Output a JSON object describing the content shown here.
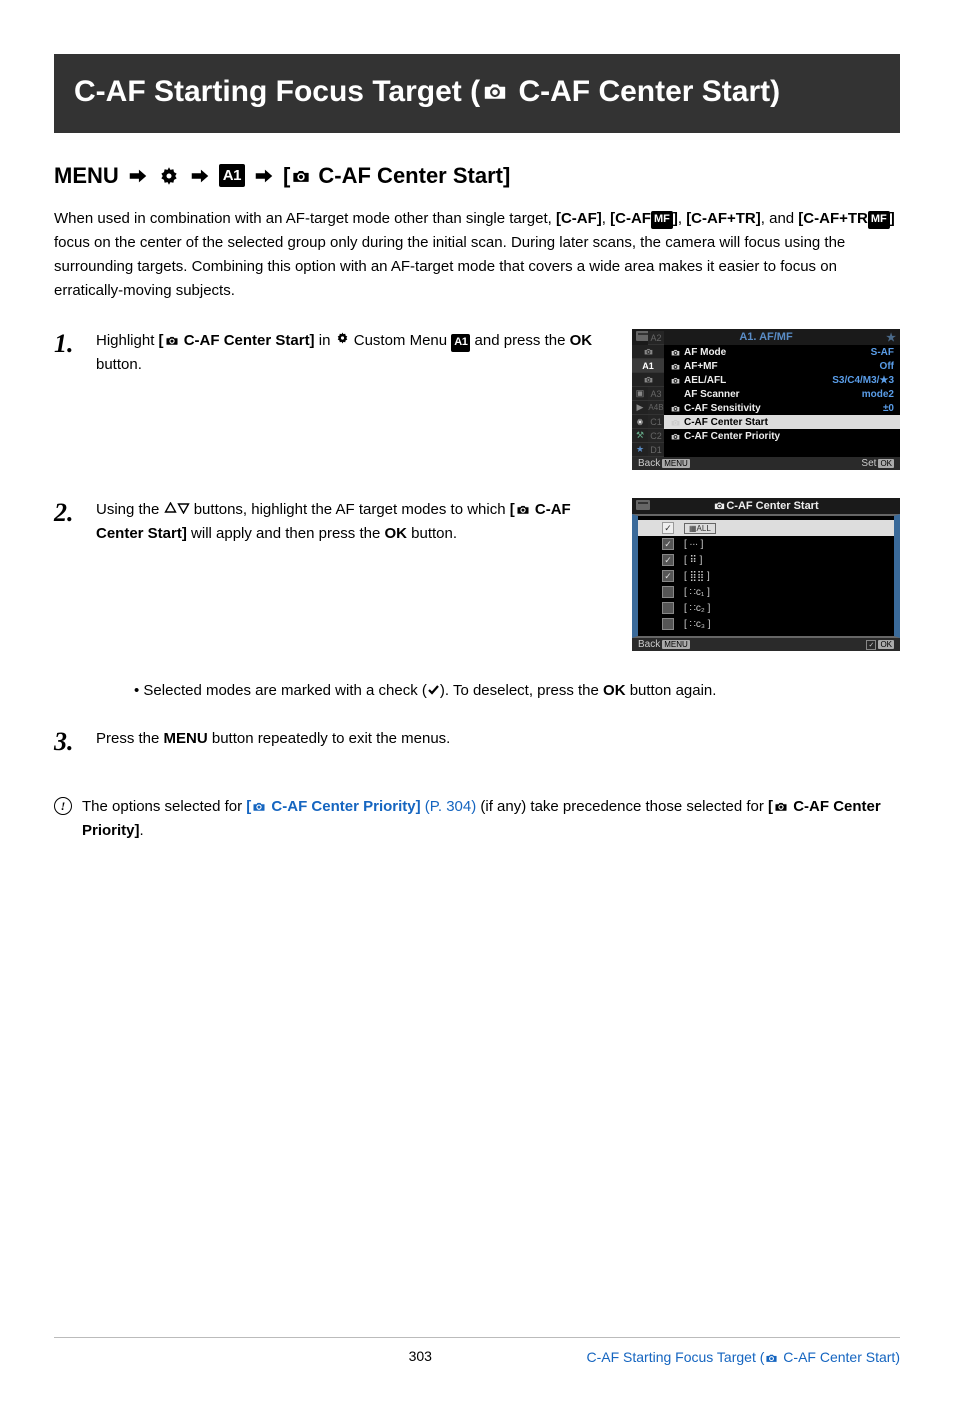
{
  "title_bar": {
    "prefix": "C-AF Starting Focus Target (",
    "label": " C-AF Center Start)"
  },
  "menu_path": {
    "menu": "MENU",
    "label_prefix": " [",
    "label": " C-AF Center Start]"
  },
  "intro": {
    "t1": "When used in combination with an AF-target mode other than single target, ",
    "caf": "[C-AF]",
    "t2": ", ",
    "cafmf": "[C-AF",
    "mf": "MF",
    "t3": "]",
    "t4": ", ",
    "caftr": "[C-AF+TR]",
    "t5": ", and ",
    "caftrmf": "[C-AF+TR",
    "t6": "]",
    "t7": " focus on the center of the selected group only during the initial scan. During later scans, the camera will focus using the surrounding targets. Combining this option with an AF-target mode that covers a wide area makes it easier to focus on erratically-moving subjects."
  },
  "steps": {
    "s1": {
      "num": "1.",
      "t1": "Highlight ",
      "bold1": "[",
      "bold_label": " C-AF Center Start]",
      "t2": " in ",
      "t3": " Custom Menu ",
      "t4": " and press the ",
      "ok": "OK",
      "t5": " button."
    },
    "s2": {
      "num": "2.",
      "t1": "Using the ",
      "t2": " buttons, highlight the AF target modes to which ",
      "bold1": "[",
      "bold_label": " C-AF Center Start]",
      "t3": " will apply and then press the ",
      "ok": "OK",
      "t4": " button."
    },
    "bullet": {
      "t1": "Selected modes are marked with a check (",
      "t2": "). To deselect, press the ",
      "ok": "OK",
      "t3": " button again."
    },
    "s3": {
      "num": "3.",
      "t1": "Press the ",
      "menu": "MENU",
      "t2": " button repeatedly to exit the menus."
    }
  },
  "note": {
    "t1": "The options selected for ",
    "link": " C-AF Center Priority]",
    "linkbr": "[",
    "page": " (P. 304)",
    "t2": " (if any) take precedence those selected for ",
    "bold": "[",
    "boldlbl": " C-AF Center Priority]",
    "t3": "."
  },
  "shot1": {
    "header": "A1. AF/MF",
    "side_tabs": [
      "A1",
      "A2",
      "A3",
      "A4",
      "B",
      "C1",
      "C2",
      "D1"
    ],
    "rows": [
      {
        "label": "AF Mode",
        "value": "S-AF"
      },
      {
        "label": "AF+MF",
        "value": "Off"
      },
      {
        "label": "AEL/AFL",
        "value": "S3/C4/M3/",
        "star": "3"
      },
      {
        "label": "AF Scanner",
        "value": "mode2",
        "noicon": true
      },
      {
        "label": "C-AF Sensitivity",
        "value": "±0"
      },
      {
        "label": "C-AF Center Start",
        "value": "",
        "selected": true
      },
      {
        "label": "C-AF Center Priority",
        "value": ""
      }
    ],
    "back": "Back",
    "backbadge": "MENU",
    "set": "Set",
    "setbadge": "OK"
  },
  "shot2": {
    "header": "C-AF Center Start",
    "rows": [
      {
        "checked": true,
        "selected": true,
        "icon": "all"
      },
      {
        "checked": true,
        "icon": "small"
      },
      {
        "checked": true,
        "icon": "mid1"
      },
      {
        "checked": true,
        "icon": "mid2"
      },
      {
        "checked": false,
        "icon": "c1"
      },
      {
        "checked": false,
        "icon": "c2"
      },
      {
        "checked": false,
        "icon": "c3"
      }
    ],
    "back": "Back",
    "backbadge": "MENU",
    "okbadge": "OK"
  },
  "footer": {
    "page": "303",
    "crumb_prefix": "C-AF Starting Focus Target (",
    "crumb_suffix": " C-AF Center Start)"
  }
}
